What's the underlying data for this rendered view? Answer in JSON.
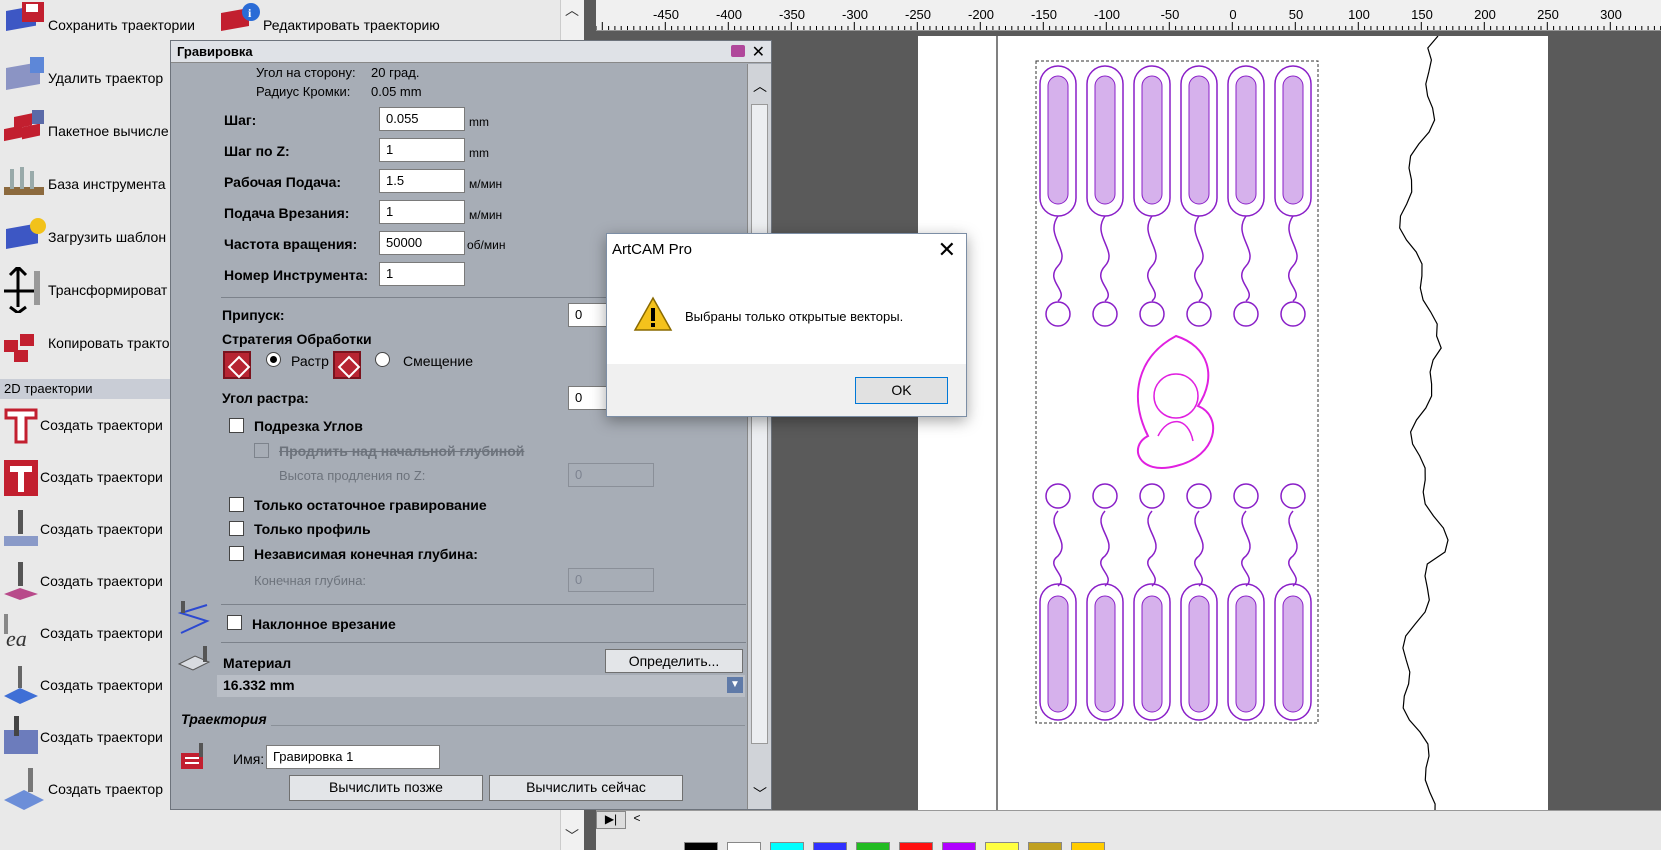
{
  "toolbar": {
    "save_toolpath": "Сохранить траектории",
    "edit_toolpath": "Редактировать траекторию",
    "items": [
      "Удалить траектор",
      "Пакетное вычисле",
      "База инструмента",
      "Загрузить шаблон",
      "Трансформироват",
      "Копировать тракто"
    ],
    "section_2d": "2D траектории",
    "items_2d": [
      "Создать траектори",
      "Создать траектори",
      "Создать траектори",
      "Создать траектори",
      "Создать траектори",
      "Создать траектори",
      "Создать траектори",
      "Создать траектор"
    ]
  },
  "ruler": {
    "labels": [
      "-450",
      "-400",
      "-350",
      "-300",
      "-250",
      "-200",
      "-150",
      "-100",
      "-50",
      "0",
      "50",
      "100",
      "150",
      "200",
      "250",
      "300"
    ]
  },
  "engrave_panel": {
    "title": "Гравировка",
    "side_angle_label": "Угол на сторону:",
    "side_angle_value": "20 град.",
    "edge_radius_label": "Радиус Кромки:",
    "edge_radius_value": "0.05 mm",
    "step_label": "Шаг:",
    "step_value": "0.055",
    "step_unit": "mm",
    "stepz_label": "Шаг по Z:",
    "stepz_value": "1",
    "stepz_unit": "mm",
    "feed_label": "Рабочая Подача:",
    "feed_value": "1.5",
    "feed_unit": "м/мин",
    "plunge_label": "Подача Врезания:",
    "plunge_value": "1",
    "plunge_unit": "м/мин",
    "speed_label": "Частота вращения:",
    "speed_value": "50000",
    "speed_unit": "об/мин",
    "toolno_label": "Номер Инструмента:",
    "toolno_value": "1",
    "allowance_label": "Припуск:",
    "allowance_value": "0",
    "strategy_label": "Стратегия Обработки",
    "raster_label": "Растр",
    "offset_label": "Смещение",
    "raster_angle_label": "Угол растра:",
    "raster_angle_value": "0",
    "corner_cut_label": "Подрезка Углов",
    "extend_label": "Продлить над начальной глубиной",
    "extend_height_label": "Высота продления по Z:",
    "extend_height_value": "0",
    "rest_only_label": "Только остаточное гравирование",
    "profile_only_label": "Только профиль",
    "indep_depth_label": "Независимая конечная глубина:",
    "final_depth_label": "Конечная глубина:",
    "final_depth_value": "0",
    "ramp_label": "Наклонное врезание",
    "material_label": "Материал",
    "define_button": "Определить...",
    "material_value": "16.332 mm",
    "toolpath_section": "Траектория",
    "name_label": "Имя:",
    "name_value": "Гравировка 1",
    "calc_later": "Вычислить позже",
    "calc_now": "Вычислить сейчас"
  },
  "dialog": {
    "title": "ArtCAM Pro",
    "message": "Выбраны только открытые векторы.",
    "ok": "OK"
  },
  "palette": {
    "colors": [
      "#000000",
      "#ffffff",
      "#00ffff",
      "#3030ff",
      "#22bb22",
      "#ff1010",
      "#b000ff",
      "#ffff40",
      "#c0a020",
      "#ffcc00"
    ]
  },
  "colors": {
    "vector_purple": "#8a1fc8",
    "vector_magenta": "#e020e0"
  }
}
